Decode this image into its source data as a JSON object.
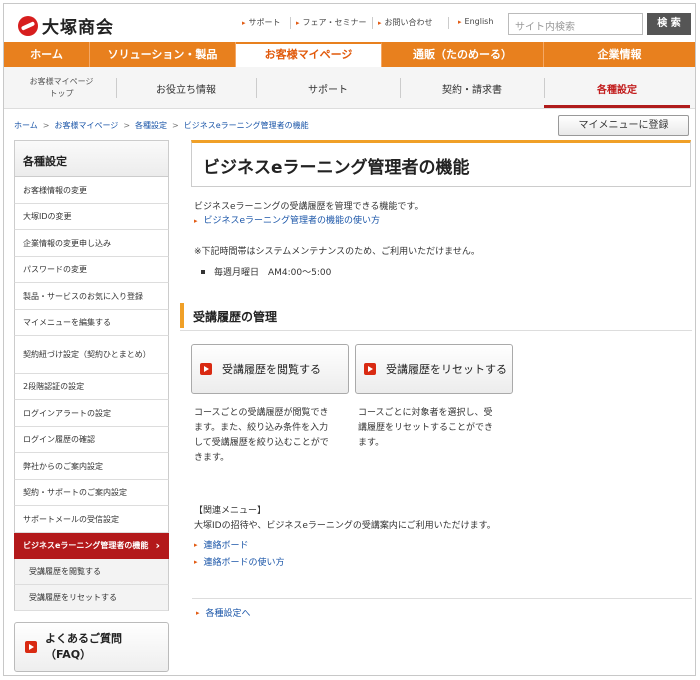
{
  "header": {
    "logo_text": "大塚商会",
    "util_links": [
      "サポート",
      "フェア・セミナー",
      "お問い合わせ",
      "English"
    ],
    "search_placeholder": "サイト内検索",
    "search_button": "検 索"
  },
  "main_nav": [
    "ホーム",
    "ソリューション・製品",
    "お客様マイページ",
    "通販（たのめーる）",
    "企業情報"
  ],
  "sub_nav": {
    "top_line1": "お客様マイページ",
    "top_line2": "トップ",
    "items": [
      "お役立ち情報",
      "サポート",
      "契約・請求書",
      "各種設定"
    ]
  },
  "breadcrumb": [
    "ホーム",
    "お客様マイページ",
    "各種設定",
    "ビジネスeラーニング管理者の機能"
  ],
  "register_button": "マイメニューに登録",
  "sidebar": {
    "title": "各種設定",
    "items": [
      "お客様情報の変更",
      "大塚IDの変更",
      "企業情報の変更申し込み",
      "パスワードの変更",
      "製品・サービスのお気に入り登録",
      "マイメニューを編集する",
      "契約紐づけ設定（契約ひとまとめ）",
      "2段階認証の設定",
      "ログインアラートの設定",
      "ログイン履歴の確認",
      "弊社からのご案内設定",
      "契約・サポートのご案内設定",
      "サポートメールの受信設定",
      "ビジネスeラーニング管理者の機能",
      "受講履歴を閲覧する",
      "受講履歴をリセットする"
    ],
    "faq_line1": "よくあるご質問",
    "faq_line2": "（FAQ）"
  },
  "main": {
    "title": "ビジネスeラーニング管理者の機能",
    "intro": "ビジネスeラーニングの受講履歴を管理できる機能です。",
    "intro_link": "ビジネスeラーニング管理者の機能の使い方",
    "maintenance_note": "※下記時間帯はシステムメンテナンスのため、ご利用いただけません。",
    "maintenance_time": "毎週月曜日　AM4:00～5:00",
    "section_title": "受講履歴の管理",
    "btn_view": "受講履歴を閲覧する",
    "btn_reset": "受講履歴をリセットする",
    "desc_view_l1": "コースごとの受講履歴が閲覧でき",
    "desc_view_l2": "ます。また、絞り込み条件を入力",
    "desc_view_l3": "して受講履歴を絞り込むことがで",
    "desc_view_l4": "きます。",
    "desc_reset_l1": "コースごとに対象者を選択し、受",
    "desc_reset_l2": "講履歴をリセットすることができ",
    "desc_reset_l3": "ます。",
    "related_title": "【関連メニュー】",
    "related_text": "大塚IDの招待や、ビジネスeラーニングの受講案内にご利用いただけます。",
    "related_links": [
      "連絡ボード",
      "連絡ボードの使い方"
    ],
    "back_link": "各種設定へ"
  },
  "colors": {
    "brand_orange": "#e8801e",
    "active_red": "#b3191b",
    "link_blue": "#1a55a8",
    "accent_gold": "#f0a028"
  }
}
